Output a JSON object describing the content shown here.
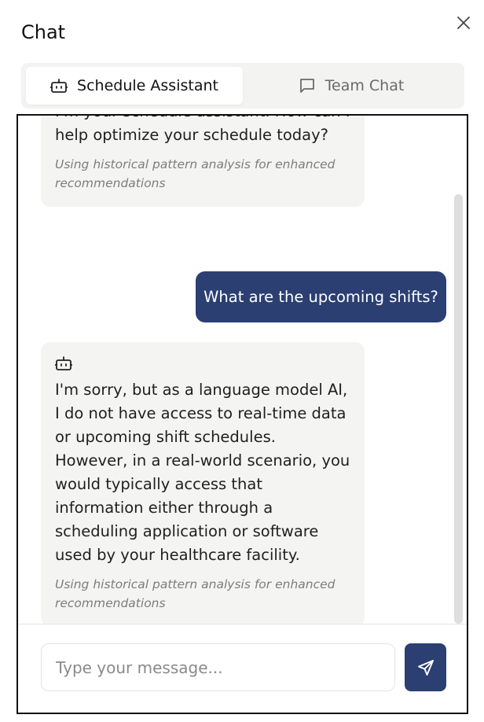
{
  "panel": {
    "title": "Chat"
  },
  "tabs": [
    {
      "label": "Schedule Assistant",
      "icon": "robot-icon",
      "active": true
    },
    {
      "label": "Team Chat",
      "icon": "message-square-icon",
      "active": false
    }
  ],
  "messages": [
    {
      "role": "assistant",
      "text": "I'm your schedule assistant. How can I help optimize your schedule today?",
      "note": "Using historical pattern analysis for enhanced recommendations"
    },
    {
      "role": "user",
      "text": "What are the upcoming shifts?"
    },
    {
      "role": "assistant",
      "text": "I'm sorry, but as a language model AI, I do not have access to real-time data or upcoming shift schedules. However, in a real-world scenario, you would typically access that information either through a scheduling application or software used by your healthcare facility.",
      "note": "Using historical pattern analysis for enhanced recommendations"
    }
  ],
  "composer": {
    "placeholder": "Type your message...",
    "value": ""
  },
  "colors": {
    "accent": "#2b3f73",
    "bot_bubble": "#f4f4f2",
    "tab_bg": "#f3f3f2"
  }
}
